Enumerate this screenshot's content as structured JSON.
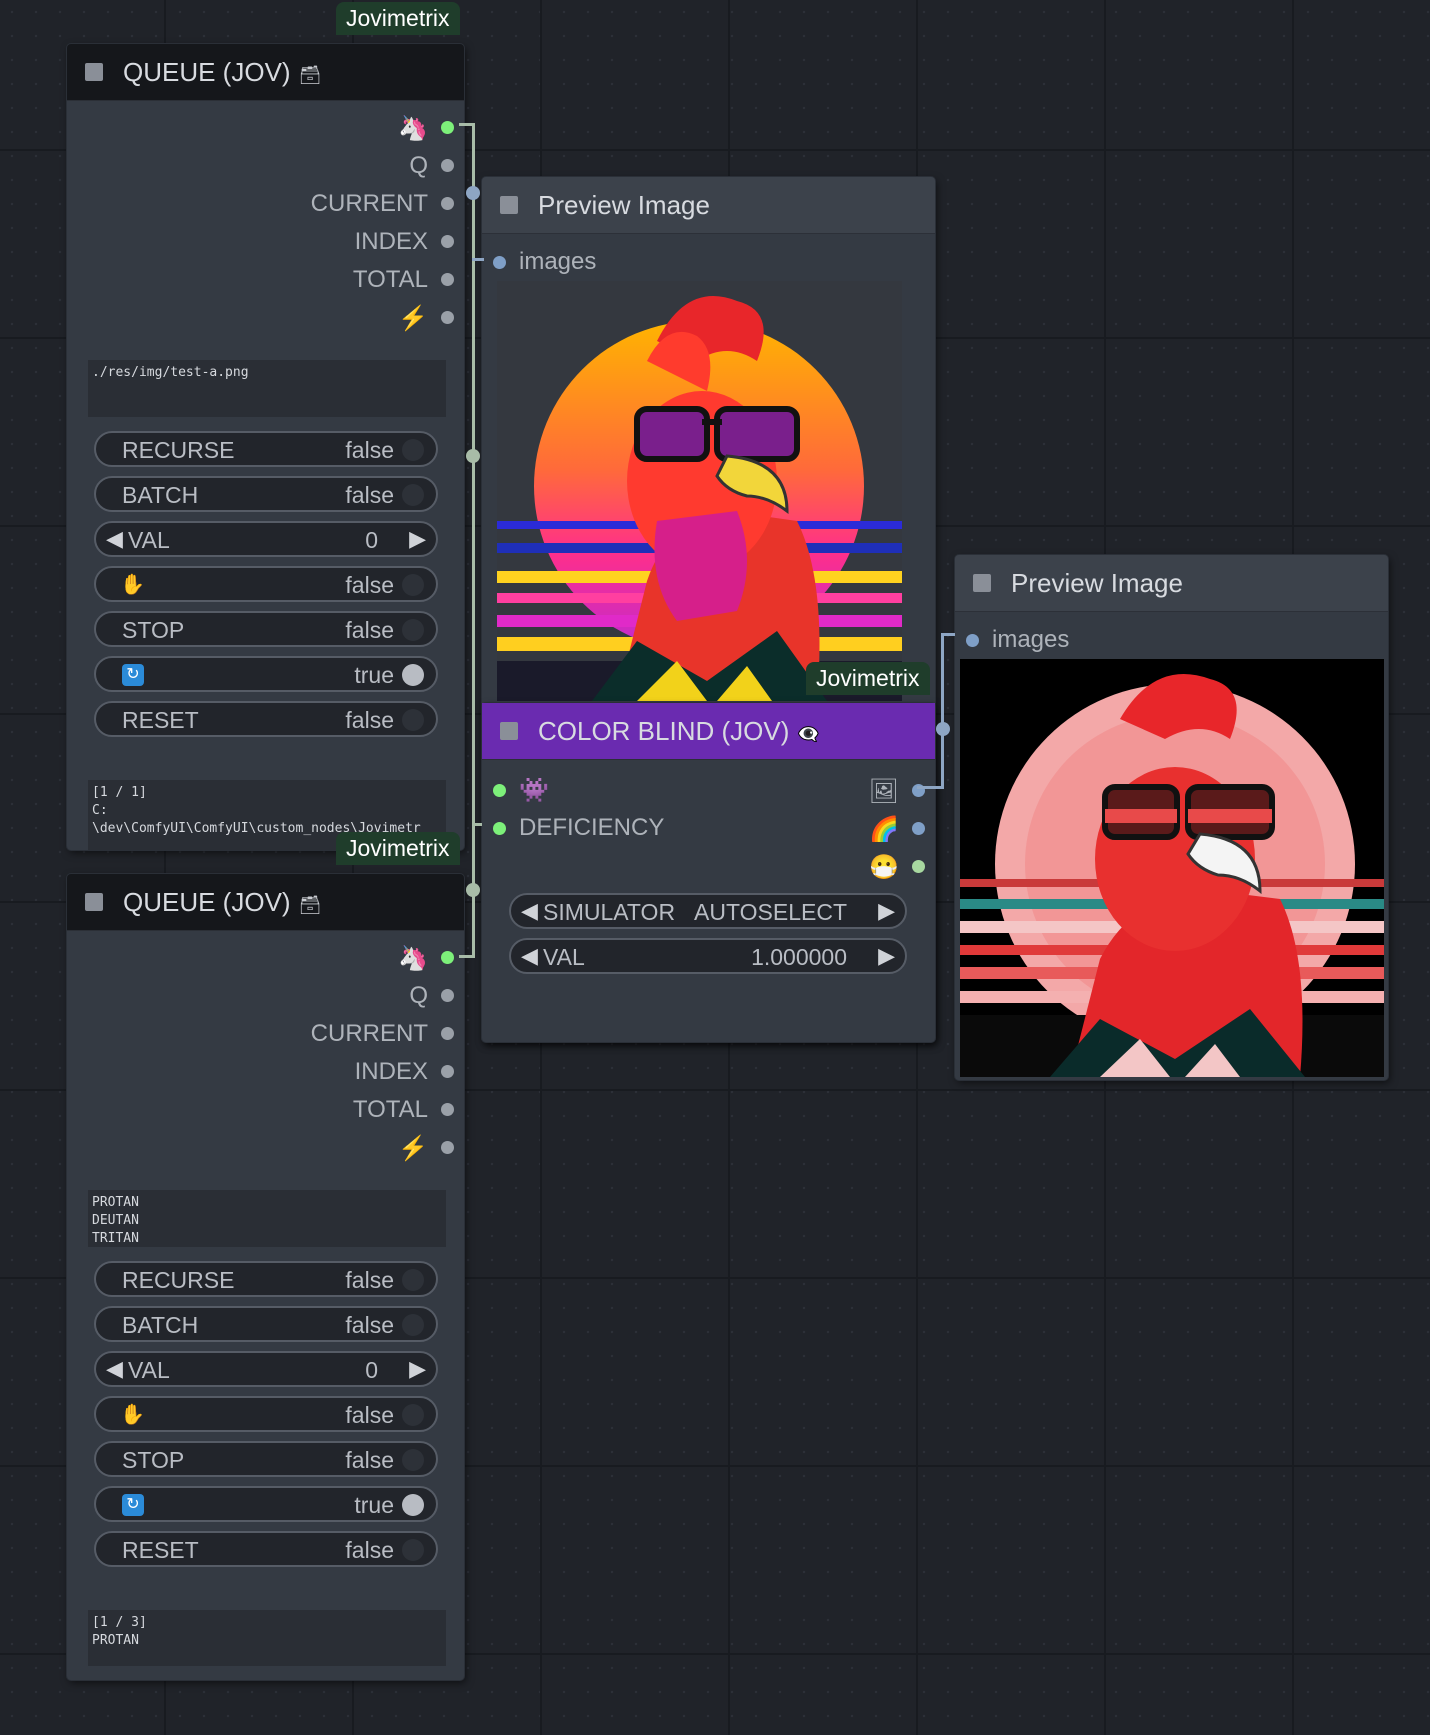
{
  "badge": "Jovimetrix",
  "queue_nodes": [
    {
      "title": "QUEUE (JOV)",
      "title_icon": "🗃",
      "outputs": [
        {
          "label": "",
          "icon": "unicorn-icon",
          "glyph": "🦄",
          "dot": "green"
        },
        {
          "label": "Q",
          "dot": "gray"
        },
        {
          "label": "CURRENT",
          "dot": "gray"
        },
        {
          "label": "INDEX",
          "dot": "gray"
        },
        {
          "label": "TOTAL",
          "dot": "gray"
        },
        {
          "label": "",
          "icon": "lightning-icon",
          "glyph": "⚡",
          "dot": "gray"
        }
      ],
      "input_text": "./res/img/test-a.png",
      "widgets": [
        {
          "label": "RECURSE",
          "value": "false",
          "kind": "toggle",
          "on": false
        },
        {
          "label": "BATCH",
          "value": "false",
          "kind": "toggle",
          "on": false
        },
        {
          "label": "VAL",
          "value": "0",
          "kind": "number"
        },
        {
          "label": "",
          "icon": "hand-icon",
          "value": "false",
          "kind": "toggle",
          "on": false
        },
        {
          "label": "STOP",
          "value": "false",
          "kind": "toggle",
          "on": false
        },
        {
          "label": "",
          "icon": "cycle-icon",
          "value": "true",
          "kind": "toggle",
          "on": true
        },
        {
          "label": "RESET",
          "value": "false",
          "kind": "toggle",
          "on": false
        }
      ],
      "status_text": "[1 / 1]\nC:\n\\dev\\ComfyUI\\ComfyUI\\custom_nodes\\Jovimetr"
    },
    {
      "title": "QUEUE (JOV)",
      "title_icon": "🗃",
      "outputs": [
        {
          "label": "",
          "icon": "unicorn-icon",
          "glyph": "🦄",
          "dot": "green"
        },
        {
          "label": "Q",
          "dot": "gray"
        },
        {
          "label": "CURRENT",
          "dot": "gray"
        },
        {
          "label": "INDEX",
          "dot": "gray"
        },
        {
          "label": "TOTAL",
          "dot": "gray"
        },
        {
          "label": "",
          "icon": "lightning-icon",
          "glyph": "⚡",
          "dot": "gray"
        }
      ],
      "input_text": "PROTAN\nDEUTAN\nTRITAN",
      "widgets": [
        {
          "label": "RECURSE",
          "value": "false",
          "kind": "toggle",
          "on": false
        },
        {
          "label": "BATCH",
          "value": "false",
          "kind": "toggle",
          "on": false
        },
        {
          "label": "VAL",
          "value": "0",
          "kind": "number"
        },
        {
          "label": "",
          "icon": "hand-icon",
          "value": "false",
          "kind": "toggle",
          "on": false
        },
        {
          "label": "STOP",
          "value": "false",
          "kind": "toggle",
          "on": false
        },
        {
          "label": "",
          "icon": "cycle-icon",
          "value": "true",
          "kind": "toggle",
          "on": true
        },
        {
          "label": "RESET",
          "value": "false",
          "kind": "toggle",
          "on": false
        }
      ],
      "status_text": "[1 / 3]\nPROTAN"
    }
  ],
  "preview_1": {
    "title": "Preview Image",
    "input": "images"
  },
  "preview_2": {
    "title": "Preview Image",
    "input": "images"
  },
  "color_blind": {
    "title": "COLOR BLIND (JOV)",
    "title_icons": "👁‍🗨",
    "inputs": [
      {
        "label": "",
        "icon": "alien-monster-icon",
        "glyph": "👾"
      },
      {
        "label": "DEFICIENCY"
      }
    ],
    "outputs": [
      {
        "icon": "image-icon",
        "glyph": "🖼",
        "dot": "blue"
      },
      {
        "icon": "rainbow-icon",
        "glyph": "🌈",
        "dot": "blue"
      },
      {
        "icon": "mask-icon",
        "glyph": "😷",
        "dot": "lime"
      }
    ],
    "simulator": {
      "label": "SIMULATOR",
      "value": "AUTOSELECT"
    },
    "val": {
      "label": "VAL",
      "value": "1.000000"
    }
  },
  "colors": {
    "canvas": "#202329",
    "node_body": "#343a43",
    "color_blind_header": "#6a2bb0",
    "badge_bg": "#1f3d2b",
    "wire_green": "#a8bca8",
    "wire_blue": "#8ea6c4"
  }
}
